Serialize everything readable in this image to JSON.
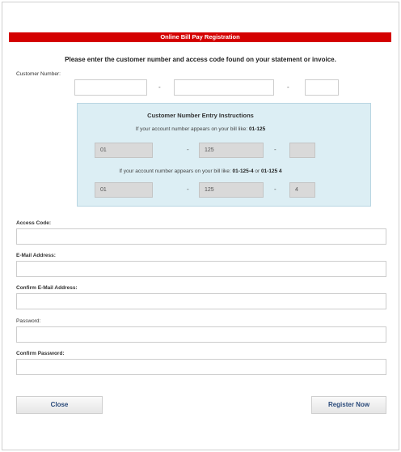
{
  "banner": {
    "title": "Online Bill Pay Registration"
  },
  "instruction": "Please enter the customer number and access code found on your statement or invoice.",
  "customer_number": {
    "label": "Customer Number:",
    "separator": "-"
  },
  "help_panel": {
    "title": "Customer Number Entry Instructions",
    "example1": {
      "text": "If your account number appears on your bill like:",
      "sample": "01-125",
      "fields": [
        "01",
        "125",
        ""
      ]
    },
    "example2": {
      "text": "If your account number appears on your bill like:",
      "sample_a": "01-125-4",
      "joiner": "or",
      "sample_b": "01-125 4",
      "fields": [
        "01",
        "125",
        "4"
      ]
    }
  },
  "fields": {
    "access_code": "Access Code:",
    "email": "E-Mail Address:",
    "confirm_email": "Confirm E-Mail Address:",
    "password": "Password:",
    "confirm_password": "Confirm Password:"
  },
  "buttons": {
    "close": "Close",
    "register": "Register Now"
  },
  "colors": {
    "banner": "#d40000",
    "panel": "#dceef4",
    "button_text": "#2a4a7a"
  }
}
